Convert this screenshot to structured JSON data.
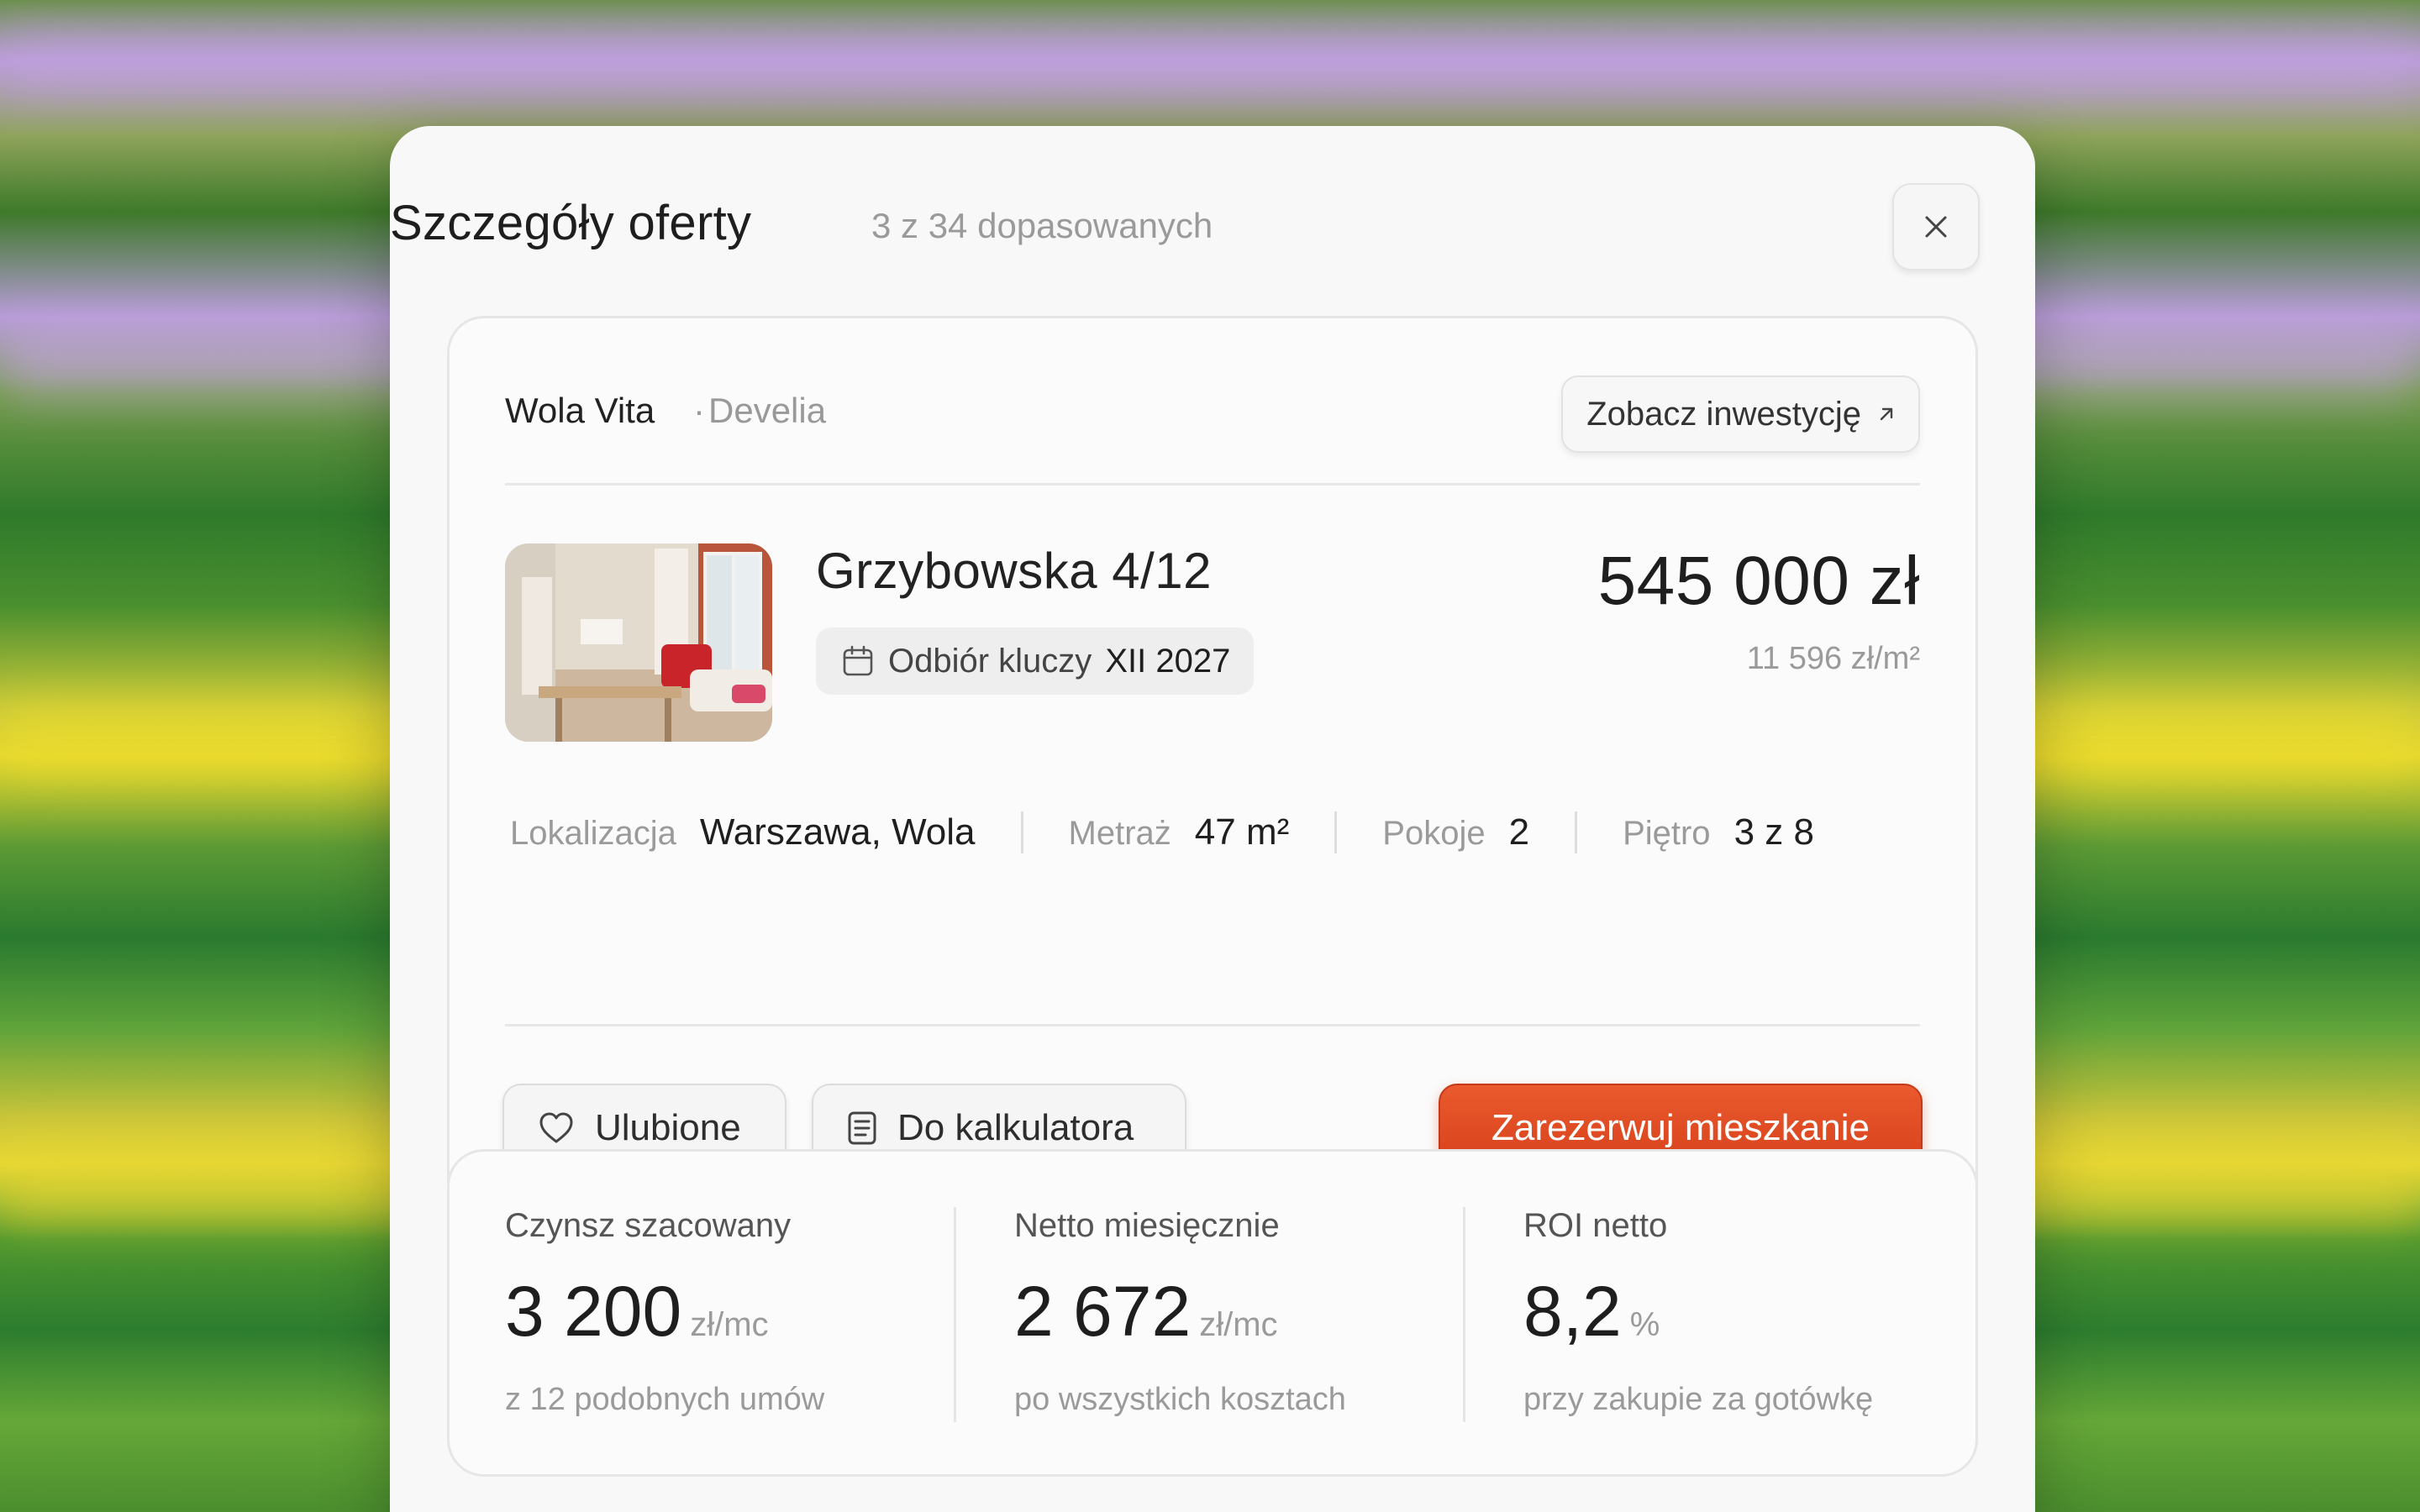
{
  "modal": {
    "title": "Szczegóły oferty",
    "subtitle": "3 z 34 dopasowanych"
  },
  "offer": {
    "investment": "Wola Vita",
    "separator": "·",
    "developer": "Develia",
    "investment_button": "Zobacz inwestycję",
    "address": "Grzybowska 4/12",
    "keys_label": "Odbiór kluczy",
    "keys_date": "XII 2027",
    "price": "545 000 zł",
    "price_per_m2": "11 596 zł/m²",
    "specs": [
      {
        "label": "Lokalizacja",
        "value": "Warszawa, Wola"
      },
      {
        "label": "Metraż",
        "value": "47 m²"
      },
      {
        "label": "Pokoje",
        "value": "2"
      },
      {
        "label": "Piętro",
        "value": "3 z 8"
      }
    ],
    "actions": {
      "favorite": "Ulubione",
      "calculator": "Do kalkulatora",
      "reserve": "Zarezerwuj mieszkanie"
    }
  },
  "stats": [
    {
      "label": "Czynsz szacowany",
      "value": "3 200",
      "unit": "zł/mc",
      "note": "z 12 podobnych umów"
    },
    {
      "label": "Netto miesięcznie",
      "value": "2 672",
      "unit": "zł/mc",
      "note": "po wszystkich kosztach"
    },
    {
      "label": "ROI netto",
      "value": "8,2",
      "unit": "%",
      "note": "przy zakupie za gotówkę"
    }
  ],
  "colors": {
    "accent": "#e04a22",
    "text_primary": "#1e1e1e",
    "text_muted": "#9a9a9a"
  }
}
